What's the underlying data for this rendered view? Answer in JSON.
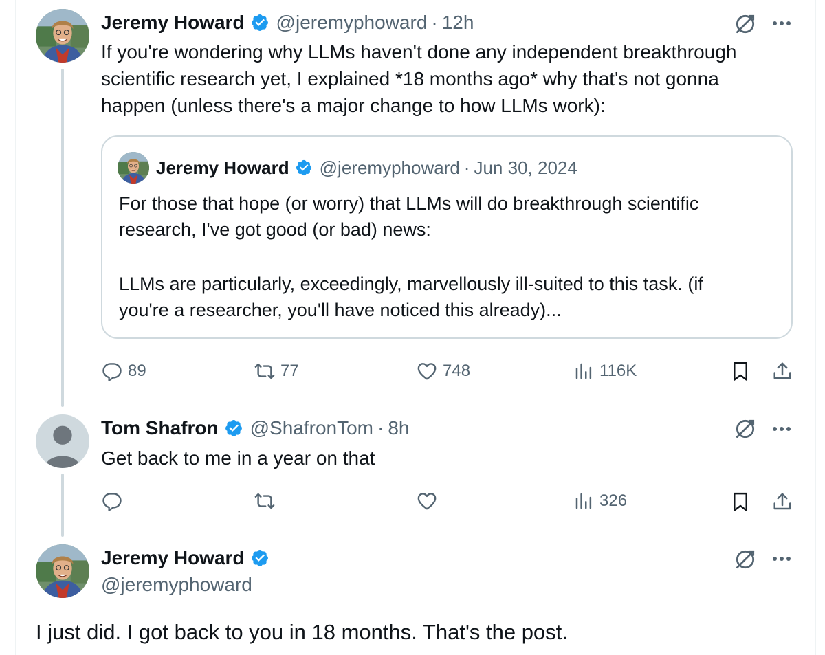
{
  "tweets": {
    "first": {
      "name": "Jeremy Howard",
      "handle": "@jeremyphoward",
      "time": "12h",
      "text_lines": [
        "If you're wondering why LLMs haven't done any independent breakthrough",
        "scientific research yet, I explained *18 months ago* why that's not gonna",
        "happen (unless there's a major change to how LLMs work):"
      ],
      "quote": {
        "name": "Jeremy Howard",
        "handle": "@jeremyphoward",
        "date": "Jun 30, 2024",
        "para1": [
          "For those that hope (or worry) that LLMs will do breakthrough scientific",
          "research, I've got good (or bad) news:"
        ],
        "para2": [
          "LLMs are particularly, exceedingly, marvellously ill-suited to this task. (if",
          "you're a researcher, you'll have noticed this already)..."
        ]
      },
      "actions": {
        "replies": "89",
        "reposts": "77",
        "likes": "748",
        "views": "116K"
      }
    },
    "second": {
      "name": "Tom Shafron",
      "handle": "@ShafronTom",
      "time": "8h",
      "text": "Get back to me in a year on that",
      "actions": {
        "views": "326"
      }
    },
    "third": {
      "name": "Jeremy Howard",
      "handle": "@jeremyphoward",
      "text": "I just did. I got back to you in 18 months. That's the post."
    }
  },
  "separator": "·",
  "icons": {
    "verified": "verified-badge-icon",
    "grok": "grok-icon",
    "more": "more-dots-icon",
    "reply": "reply-icon",
    "repost": "repost-icon",
    "like": "like-icon",
    "views": "views-icon",
    "bookmark": "bookmark-icon",
    "share": "share-icon"
  },
  "colors": {
    "verified": "#1d9bf0",
    "secondary_text": "#536471",
    "primary_text": "#0f1419",
    "border": "#cfd9de"
  }
}
